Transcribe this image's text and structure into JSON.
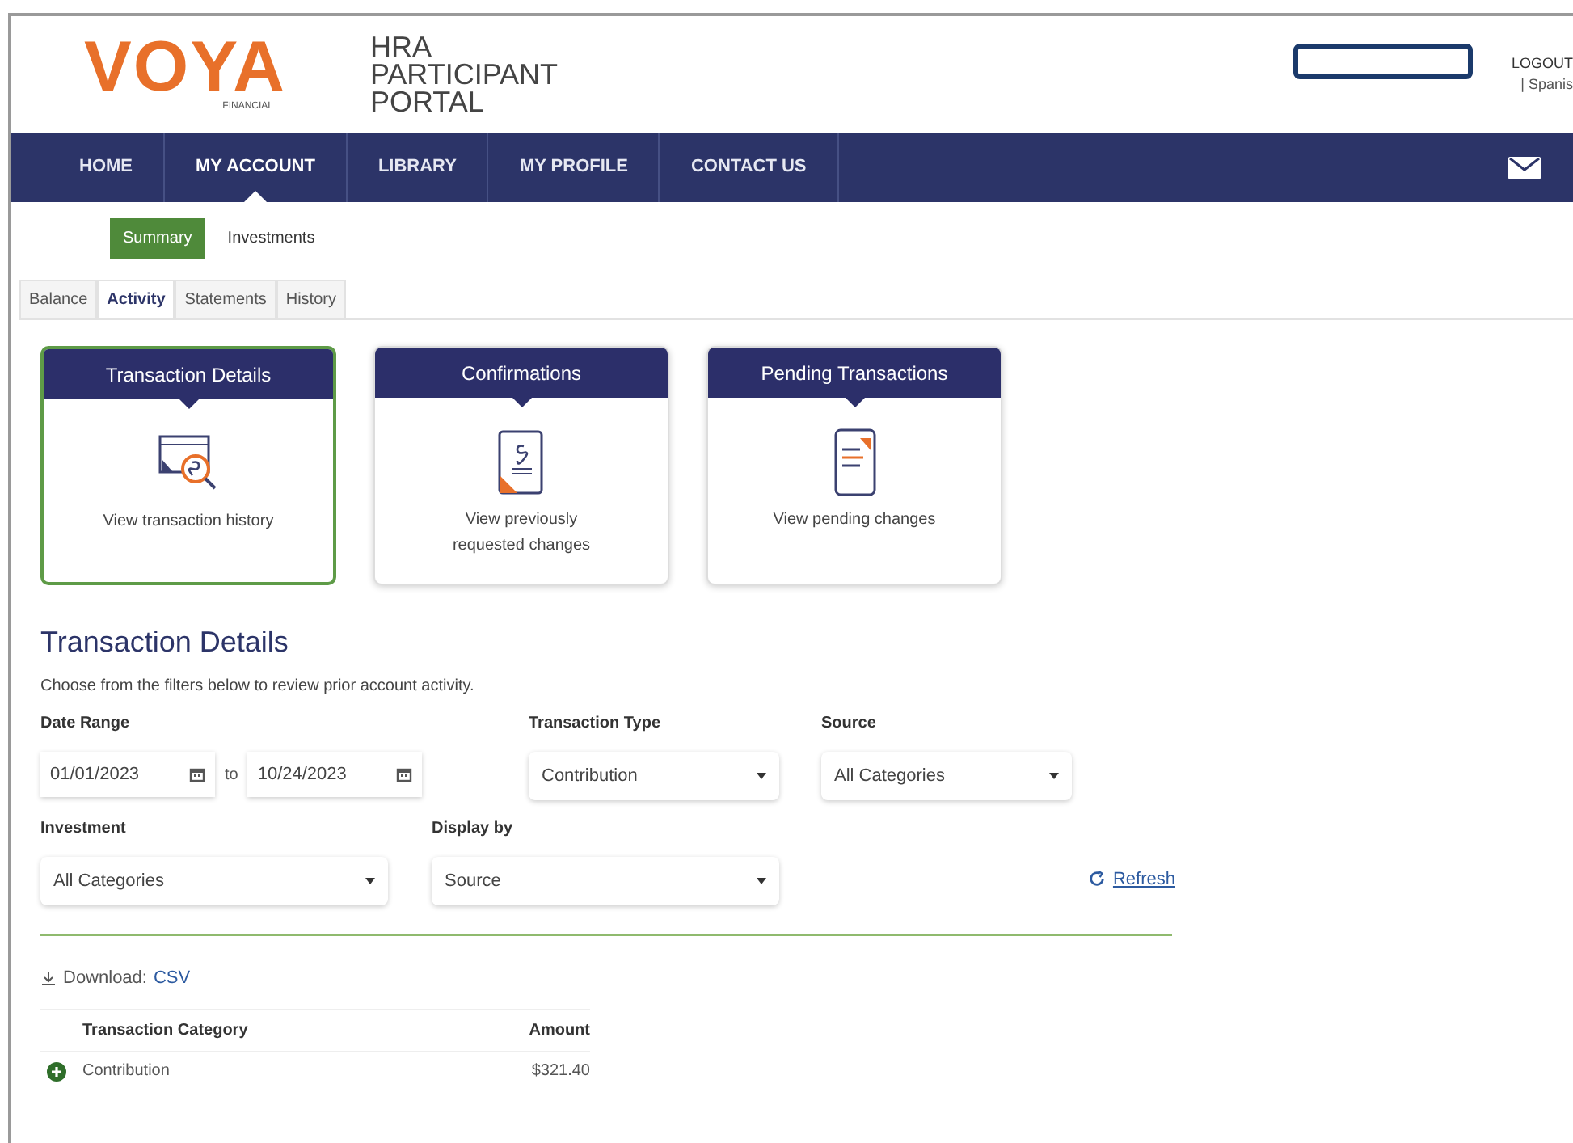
{
  "header": {
    "logo": "VOYA",
    "logo_sub": "FINANCIAL",
    "portal_title": [
      "HRA",
      "PARTICIPANT",
      "PORTAL"
    ],
    "logout": "LOGOUT",
    "language": "| Spanis"
  },
  "nav": [
    {
      "label": "HOME",
      "selected": false
    },
    {
      "label": "MY ACCOUNT",
      "selected": true
    },
    {
      "label": "LIBRARY",
      "selected": false
    },
    {
      "label": "MY PROFILE",
      "selected": false
    },
    {
      "label": "CONTACT US",
      "selected": false
    }
  ],
  "subnav": [
    {
      "label": "Summary",
      "selected": true
    },
    {
      "label": "Investments",
      "selected": false
    }
  ],
  "tabs": [
    {
      "label": "Balance",
      "selected": false
    },
    {
      "label": "Activity",
      "selected": true
    },
    {
      "label": "Statements",
      "selected": false
    },
    {
      "label": "History",
      "selected": false
    }
  ],
  "cards": [
    {
      "title": "Transaction Details",
      "text": "View transaction history",
      "kind": "history",
      "selected": true
    },
    {
      "title": "Confirmations",
      "text": "View previously requested changes",
      "kind": "receipt",
      "selected": false
    },
    {
      "title": "Pending Transactions",
      "text": "View pending changes",
      "kind": "phone",
      "selected": false
    }
  ],
  "section": {
    "title": "Transaction Details",
    "description": "Choose from the filters below to review prior account activity.",
    "date_range": {
      "label": "Date Range",
      "from": "01/01/2023",
      "separator": "to",
      "to": "10/24/2023"
    },
    "transaction_type": {
      "label": "Transaction Type",
      "value": "Contribution"
    },
    "source": {
      "label": "Source",
      "value": "All Categories"
    },
    "investment": {
      "label": "Investment",
      "value": "All Categories"
    },
    "display_by": {
      "label": "Display by",
      "value": "Source"
    },
    "refresh": "Refresh",
    "download_label": "Download:",
    "download_link": "CSV",
    "table": {
      "columns": [
        "Transaction Category",
        "Amount"
      ],
      "rows": [
        {
          "category": "Contribution",
          "amount": "$321.40",
          "expanded": false
        }
      ]
    }
  }
}
